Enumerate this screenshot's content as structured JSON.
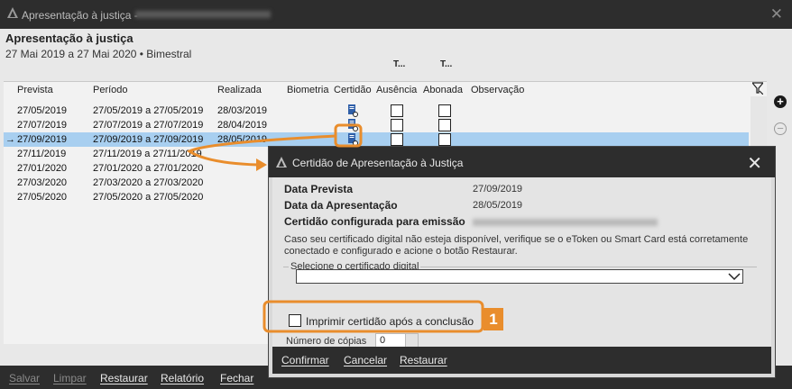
{
  "window": {
    "title": "Apresentação à justiça -",
    "close_glyph": "✕"
  },
  "page": {
    "title": "Apresentação à justiça",
    "subtitle": "27 Mai 2019 a 27 Mai 2020 • Bimestral",
    "col_extra_1": "T...",
    "col_extra_2": "T..."
  },
  "table": {
    "columns": [
      "Prevista",
      "Período",
      "Realizada",
      "Biometria",
      "Certidão",
      "Ausência",
      "Abonada",
      "Observação"
    ],
    "rows": [
      {
        "prevista": "27/05/2019",
        "periodo": "27/05/2019 a 27/05/2019",
        "realizada": "28/03/2019",
        "certidao": true,
        "checkboxes": true,
        "selected": false
      },
      {
        "prevista": "27/07/2019",
        "periodo": "27/07/2019 a 27/07/2019",
        "realizada": "28/04/2019",
        "certidao": true,
        "checkboxes": true,
        "selected": false
      },
      {
        "prevista": "27/09/2019",
        "periodo": "27/09/2019 a 27/09/2019",
        "realizada": "28/05/2019",
        "certidao": true,
        "checkboxes": true,
        "selected": true
      },
      {
        "prevista": "27/11/2019",
        "periodo": "27/11/2019 a 27/11/2019",
        "realizada": "",
        "certidao": false,
        "checkboxes": true,
        "selected": false
      },
      {
        "prevista": "27/01/2020",
        "periodo": "27/01/2020 a 27/01/2020",
        "realizada": "",
        "certidao": false,
        "checkboxes": false,
        "selected": false
      },
      {
        "prevista": "27/03/2020",
        "periodo": "27/03/2020 a 27/03/2020",
        "realizada": "",
        "certidao": false,
        "checkboxes": false,
        "selected": false
      },
      {
        "prevista": "27/05/2020",
        "periodo": "27/05/2020 a 27/05/2020",
        "realizada": "",
        "certidao": false,
        "checkboxes": false,
        "selected": false
      }
    ],
    "current_row_marker": "→"
  },
  "side_buttons": {
    "add": "+",
    "remove": "−"
  },
  "bottom_bar": {
    "salvar": "Salvar",
    "limpar": "Limpar",
    "restaurar": "Restaurar",
    "relatorio": "Relatório",
    "fechar": "Fechar"
  },
  "dialog": {
    "title": "Certidão de Apresentação à Justiça",
    "close_glyph": "✕",
    "data_prevista_label": "Data Prevista",
    "data_prevista_value": "27/09/2019",
    "data_apresentacao_label": "Data da Apresentação",
    "data_apresentacao_value": "28/05/2019",
    "certidao_label": "Certidão configurada para emissão",
    "info_text": "Caso seu certificado digital não esteja disponível, verifique se o eToken ou Smart Card está corretamente conectado e configurado e acione o botão Restaurar.",
    "cert_group_label": "Selecione o certificado digital",
    "cert_select_value": "",
    "print_label": "Imprimir certidão após a conclusão",
    "print_checked": false,
    "copies_label": "Número de cópias",
    "copies_value": "0",
    "buttons": {
      "confirmar": "Confirmar",
      "cancelar": "Cancelar",
      "restaurar": "Restaurar"
    }
  },
  "annotation": {
    "badge": "1",
    "color": "#e98d2c"
  },
  "colors": {
    "selected_row": "#a8cff0",
    "titlebar": "#2d2d2d",
    "accent": "#e98d2c"
  }
}
